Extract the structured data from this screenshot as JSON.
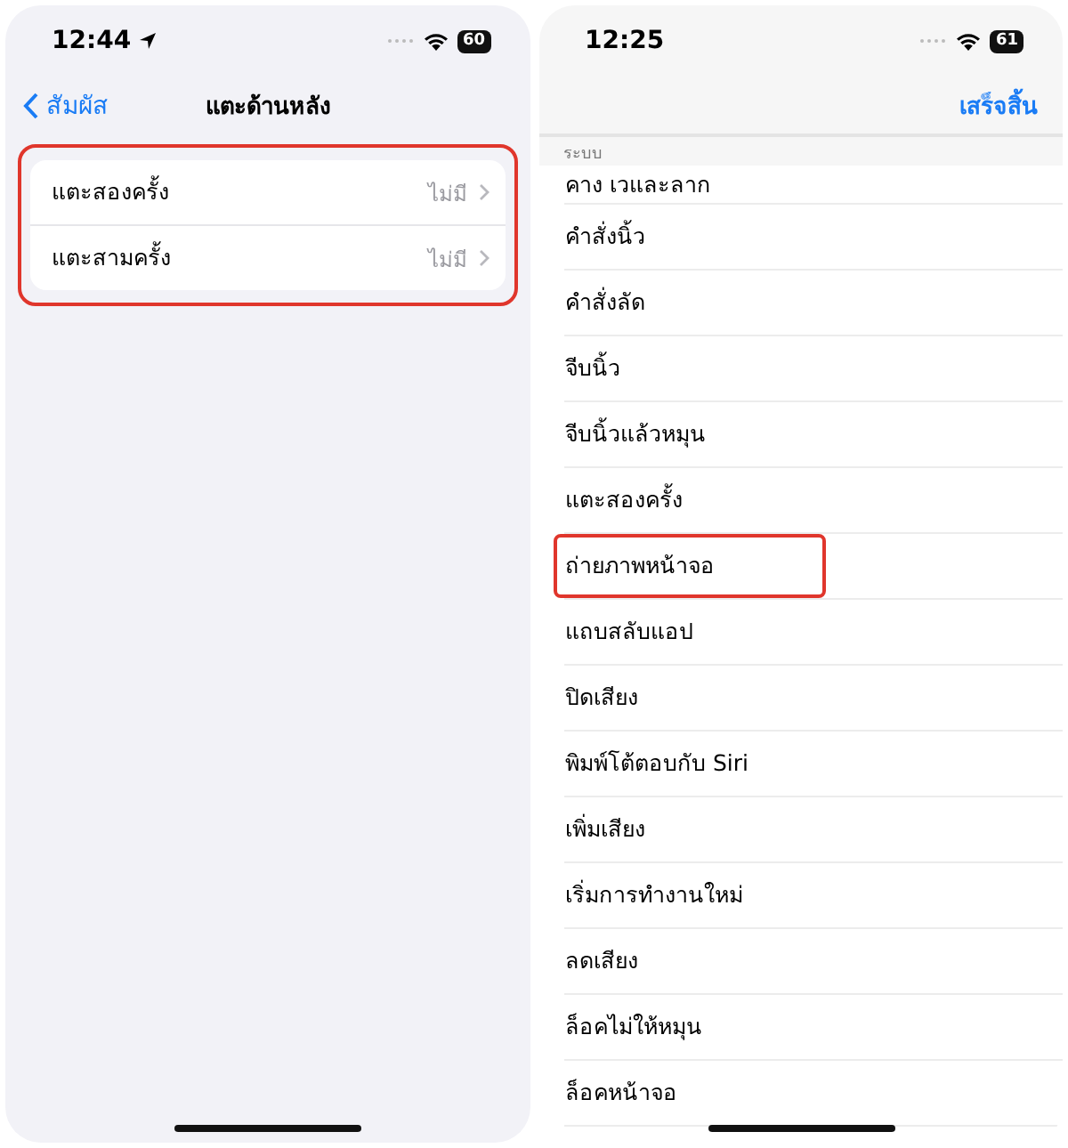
{
  "screens": [
    {
      "status_bar": {
        "time": "12:44",
        "location": true,
        "battery": "60"
      },
      "nav": {
        "back": "สัมผัส",
        "title": "แตะด้านหลัง"
      },
      "group": {
        "highlighted": true,
        "rows": [
          {
            "label": "แตะสองครั้ง",
            "value": "ไม่มี"
          },
          {
            "label": "แตะสามครั้ง",
            "value": "ไม่มี"
          }
        ]
      }
    },
    {
      "status_bar": {
        "time": "12:25",
        "location": false,
        "battery": "61"
      },
      "nav": {
        "done": "เสร็จสิ้น"
      },
      "section": "ระบบ",
      "items": [
        {
          "label": "คาง เวและลาก",
          "highlighted": false
        },
        {
          "label": "คำสั่งนิ้ว",
          "highlighted": false
        },
        {
          "label": "คำสั่งลัด",
          "highlighted": false
        },
        {
          "label": "จีบนิ้ว",
          "highlighted": false
        },
        {
          "label": "จีบนิ้วแล้วหมุน",
          "highlighted": false
        },
        {
          "label": "แตะสองครั้ง",
          "highlighted": false
        },
        {
          "label": "ถ่ายภาพหน้าจอ",
          "highlighted": true
        },
        {
          "label": "แถบสลับแอป",
          "highlighted": false
        },
        {
          "label": "ปิดเสียง",
          "highlighted": false
        },
        {
          "label": "พิมพ์โต้ตอบกับ Siri",
          "highlighted": false
        },
        {
          "label": "เพิ่มเสียง",
          "highlighted": false
        },
        {
          "label": "เริ่มการทำงานใหม่",
          "highlighted": false
        },
        {
          "label": "ลดเสียง",
          "highlighted": false
        },
        {
          "label": "ล็อคไม่ให้หมุน",
          "highlighted": false
        },
        {
          "label": "ล็อคหน้าจอ",
          "highlighted": false
        }
      ]
    }
  ]
}
